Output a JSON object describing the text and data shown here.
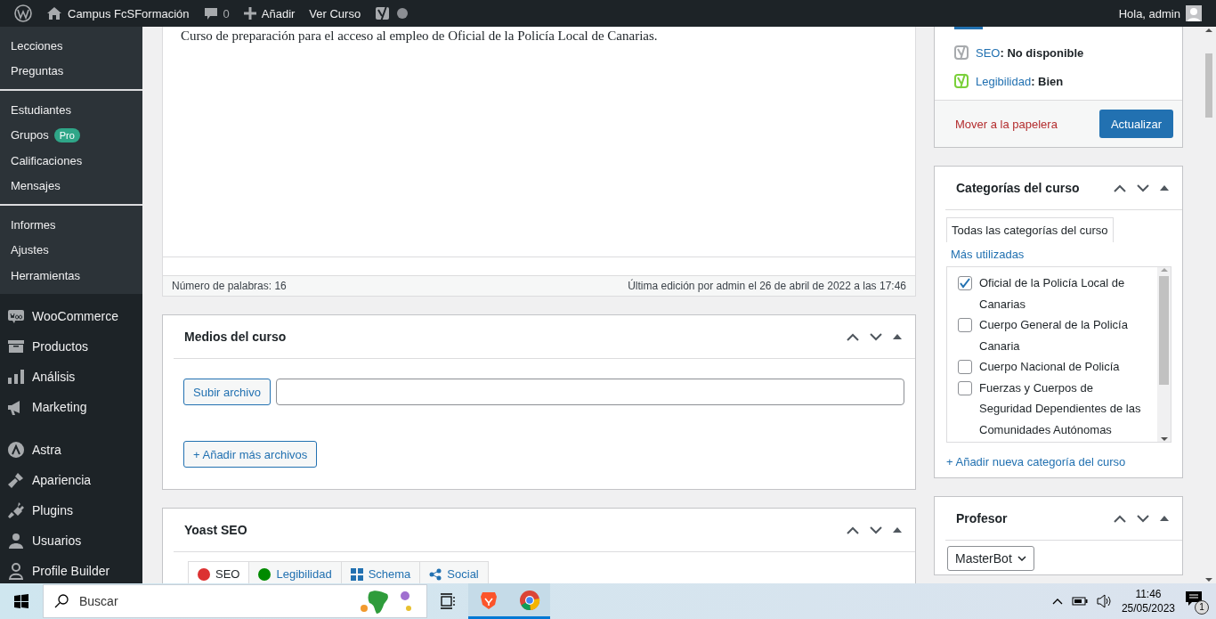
{
  "admin_bar": {
    "site": "Campus FcSFormación",
    "comments": "0",
    "new": "Añadir",
    "view": "Ver Curso",
    "greeting": "Hola, admin"
  },
  "sidebar": {
    "sub_sections": [
      [
        {
          "label": "Lecciones"
        },
        {
          "label": "Preguntas"
        }
      ],
      [
        {
          "label": "Estudiantes"
        },
        {
          "label": "Grupos",
          "badge": "Pro"
        },
        {
          "label": "Calificaciones"
        },
        {
          "label": "Mensajes"
        }
      ],
      [
        {
          "label": "Informes"
        },
        {
          "label": "Ajustes"
        },
        {
          "label": "Herramientas"
        }
      ]
    ],
    "menu_groups": [
      [
        {
          "label": "WooCommerce"
        },
        {
          "label": "Productos"
        },
        {
          "label": "Análisis"
        },
        {
          "label": "Marketing"
        }
      ],
      [
        {
          "label": "Astra"
        },
        {
          "label": "Apariencia"
        },
        {
          "label": "Plugins"
        },
        {
          "label": "Usuarios"
        },
        {
          "label": "Profile Builder"
        }
      ]
    ]
  },
  "editor": {
    "text": "Curso de preparación para el acceso al empleo de Oficial de la Policía Local de Canarias.",
    "word_count": "Número de palabras: 16",
    "last_edit": "Última edición por admin el 26 de abril de 2022 a las 17:46"
  },
  "media_box": {
    "title": "Medios del curso",
    "upload_button": "Subir archivo",
    "add_more_button": "+ Añadir más archivos"
  },
  "yoast_box": {
    "title": "Yoast SEO",
    "tabs": [
      {
        "label": "SEO",
        "selected": true,
        "color": "#dc3232"
      },
      {
        "label": "Legibilidad",
        "selected": false,
        "color": "#008a00"
      },
      {
        "label": "Schema",
        "selected": false
      },
      {
        "label": "Social",
        "selected": false
      }
    ]
  },
  "publish_box": {
    "scores": [
      {
        "link": "SEO",
        "value": ": No disponible",
        "color": "#a7aaad"
      },
      {
        "link": "Legibilidad",
        "value": ": Bien",
        "color": "#7ad03a"
      }
    ],
    "trash_link": "Mover a la papelera",
    "update_button": "Actualizar"
  },
  "categories_box": {
    "title": "Categorías del curso",
    "tabs": [
      {
        "label": "Todas las categorías del curso",
        "selected": true
      },
      {
        "label": "Más utilizadas",
        "selected": false
      }
    ],
    "items": [
      {
        "label": "Oficial de la Policía Local de Canarias",
        "checked": true
      },
      {
        "label": "Cuerpo General de la Policía Canaria",
        "checked": false
      },
      {
        "label": "Cuerpo Nacional de Policía",
        "checked": false
      },
      {
        "label": "Fuerzas y Cuerpos de Seguridad Dependientes de las Comunidades Autónomas",
        "checked": false
      }
    ],
    "add_link": "+ Añadir nueva categoría del curso"
  },
  "teacher_box": {
    "title": "Profesor",
    "value": "MasterBot"
  },
  "taskbar": {
    "search_placeholder": "Buscar",
    "time": "11:46",
    "date": "25/05/2023",
    "notifications": "1"
  }
}
